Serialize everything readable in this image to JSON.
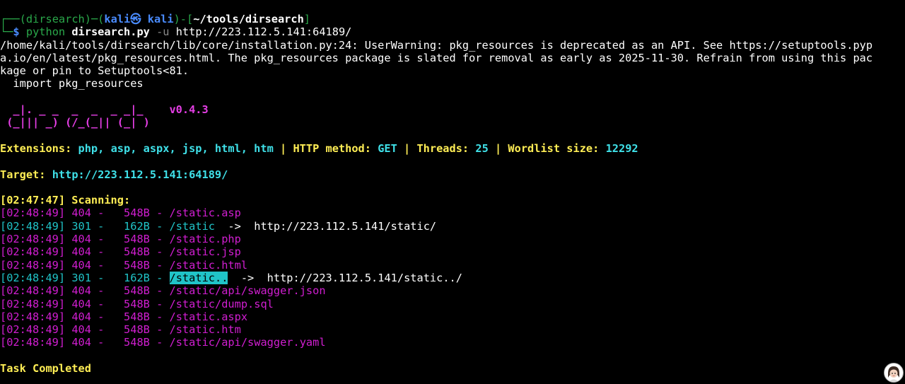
{
  "prompt": {
    "corner_top": "┌──",
    "env": "(dirsearch)",
    "dash": "─",
    "open_paren": "(",
    "user_host": "kali㉿ kali",
    "close_paren": ")",
    "dash2": "-",
    "open_bracket": "[",
    "cwd": "~/tools/dirsearch",
    "close_bracket": "]",
    "corner_bottom": "└─",
    "dollar": "$",
    "cmd": "python",
    "script": "dirsearch.py",
    "flag": "-u",
    "url": "http://223.112.5.141:64189/"
  },
  "warning": {
    "line1": "/home/kali/tools/dirsearch/lib/core/installation.py:24: UserWarning: pkg_resources is deprecated as an API. See https://setuptools.pyp",
    "line2": "a.io/en/latest/pkg_resources.html. The pkg_resources package is slated for removal as early as 2025-11-30. Refrain from using this pac",
    "line3": "kage or pin to Setuptools<81.",
    "line4": "  import pkg_resources"
  },
  "logo": {
    "line1": "  _|. _ _  _  _  _ _|_    ",
    "line2": " (_||| _) (/_(_|| (_| )",
    "version": "v0.4.3"
  },
  "config": {
    "ext_label": "Extensions: ",
    "ext_value": "php, asp, aspx, jsp, html, htm",
    "sep": " | ",
    "method_label": "HTTP method: ",
    "method_value": "GET",
    "threads_label": "Threads: ",
    "threads_value": "25",
    "wordlist_label": "Wordlist size: ",
    "wordlist_value": "12292"
  },
  "target": {
    "label": "Target: ",
    "value": "http://223.112.5.141:64189/"
  },
  "scan": {
    "start": "[02:47:47] Scanning:"
  },
  "results": [
    {
      "time": "[02:48:49]",
      "code": "404",
      "size": "548B",
      "path": "/static.asp",
      "redirect": ""
    },
    {
      "time": "[02:48:49]",
      "code": "301",
      "size": "162B",
      "path": "/static",
      "redirect": "http://223.112.5.141/static/"
    },
    {
      "time": "[02:48:49]",
      "code": "404",
      "size": "548B",
      "path": "/static.php",
      "redirect": ""
    },
    {
      "time": "[02:48:49]",
      "code": "404",
      "size": "548B",
      "path": "/static.jsp",
      "redirect": ""
    },
    {
      "time": "[02:48:49]",
      "code": "404",
      "size": "548B",
      "path": "/static.html",
      "redirect": ""
    },
    {
      "time": "[02:48:49]",
      "code": "301",
      "size": "162B",
      "path": "/static..",
      "redirect": "http://223.112.5.141/static../"
    },
    {
      "time": "[02:48:49]",
      "code": "404",
      "size": "548B",
      "path": "/static/api/swagger.json",
      "redirect": ""
    },
    {
      "time": "[02:48:49]",
      "code": "404",
      "size": "548B",
      "path": "/static/dump.sql",
      "redirect": ""
    },
    {
      "time": "[02:48:49]",
      "code": "404",
      "size": "548B",
      "path": "/static.aspx",
      "redirect": ""
    },
    {
      "time": "[02:48:49]",
      "code": "404",
      "size": "548B",
      "path": "/static.htm",
      "redirect": ""
    },
    {
      "time": "[02:48:49]",
      "code": "404",
      "size": "548B",
      "path": "/static/api/swagger.yaml",
      "redirect": ""
    }
  ],
  "done": "Task Completed",
  "colors": {
    "background": "#000000",
    "notfound": "#d11ed1",
    "redirect": "#20c4c8",
    "label": "#ffee55",
    "value": "#3fe0e8",
    "logo": "#e53ee5"
  },
  "icons": {
    "avatar": "avatar-icon"
  }
}
